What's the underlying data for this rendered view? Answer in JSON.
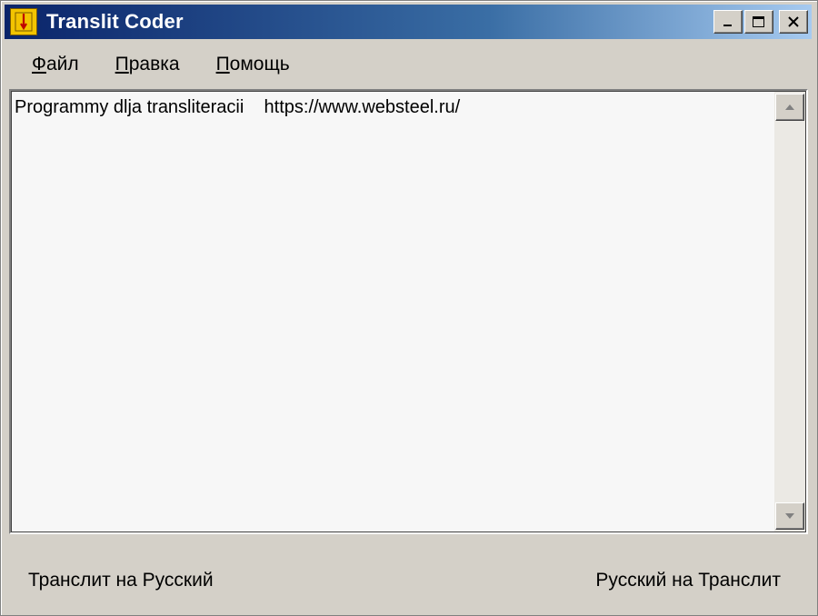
{
  "window": {
    "title": "Translit Coder",
    "colors": {
      "titlebar_start": "#0a246a",
      "titlebar_end": "#a6caf0",
      "face": "#d4d0c8",
      "app_icon": "#f2c400"
    }
  },
  "title_buttons": {
    "minimize_icon": "minimize-icon",
    "maximize_icon": "maximize-icon",
    "close_icon": "close-icon"
  },
  "menu": {
    "items": [
      {
        "mnemonic": "Ф",
        "rest": "айл"
      },
      {
        "mnemonic": "П",
        "rest": "равка"
      },
      {
        "mnemonic": "П",
        "rest": "омощь"
      }
    ]
  },
  "editor": {
    "text": "Programmy dlja transliteracii    https://www.websteel.ru/"
  },
  "buttons": {
    "translit_to_russian": "Транслит на Русский",
    "russian_to_translit": "Русский на Транслит"
  }
}
